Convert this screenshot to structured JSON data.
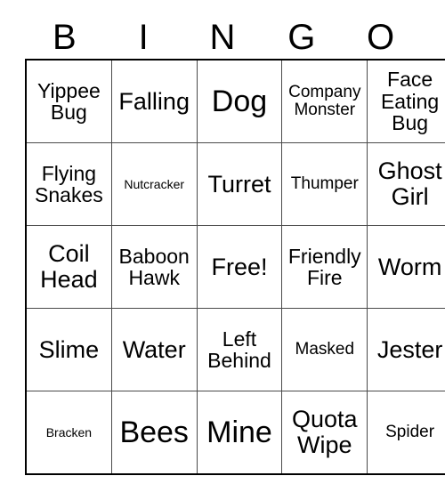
{
  "card": {
    "header": {
      "letters": [
        "B",
        "I",
        "N",
        "G",
        "O"
      ]
    },
    "free_space": "Free!",
    "rows": [
      [
        {
          "label": "Yippee Bug",
          "size": "md"
        },
        {
          "label": "Falling",
          "size": "lg"
        },
        {
          "label": "Dog",
          "size": "xl"
        },
        {
          "label": "Company Monster",
          "size": "sm"
        },
        {
          "label": "Face Eating Bug",
          "size": "md"
        }
      ],
      [
        {
          "label": "Flying Snakes",
          "size": "md"
        },
        {
          "label": "Nutcracker",
          "size": "xs"
        },
        {
          "label": "Turret",
          "size": "lg"
        },
        {
          "label": "Thumper",
          "size": "sm"
        },
        {
          "label": "Ghost Girl",
          "size": "lg"
        }
      ],
      [
        {
          "label": "Coil Head",
          "size": "lg"
        },
        {
          "label": "Baboon Hawk",
          "size": "md"
        },
        {
          "label": "Free!",
          "size": "lg"
        },
        {
          "label": "Friendly Fire",
          "size": "md"
        },
        {
          "label": "Worm",
          "size": "lg"
        }
      ],
      [
        {
          "label": "Slime",
          "size": "lg"
        },
        {
          "label": "Water",
          "size": "lg"
        },
        {
          "label": "Left Behind",
          "size": "md"
        },
        {
          "label": "Masked",
          "size": "sm"
        },
        {
          "label": "Jester",
          "size": "lg"
        }
      ],
      [
        {
          "label": "Bracken",
          "size": "xs"
        },
        {
          "label": "Bees",
          "size": "xl"
        },
        {
          "label": "Mine",
          "size": "xl"
        },
        {
          "label": "Quota Wipe",
          "size": "lg"
        },
        {
          "label": "Spider",
          "size": "sm"
        }
      ]
    ]
  },
  "colors": {
    "background": "#ffffff",
    "text": "#000000",
    "grid_line": "#4a4a4a",
    "grid_border": "#000000"
  }
}
